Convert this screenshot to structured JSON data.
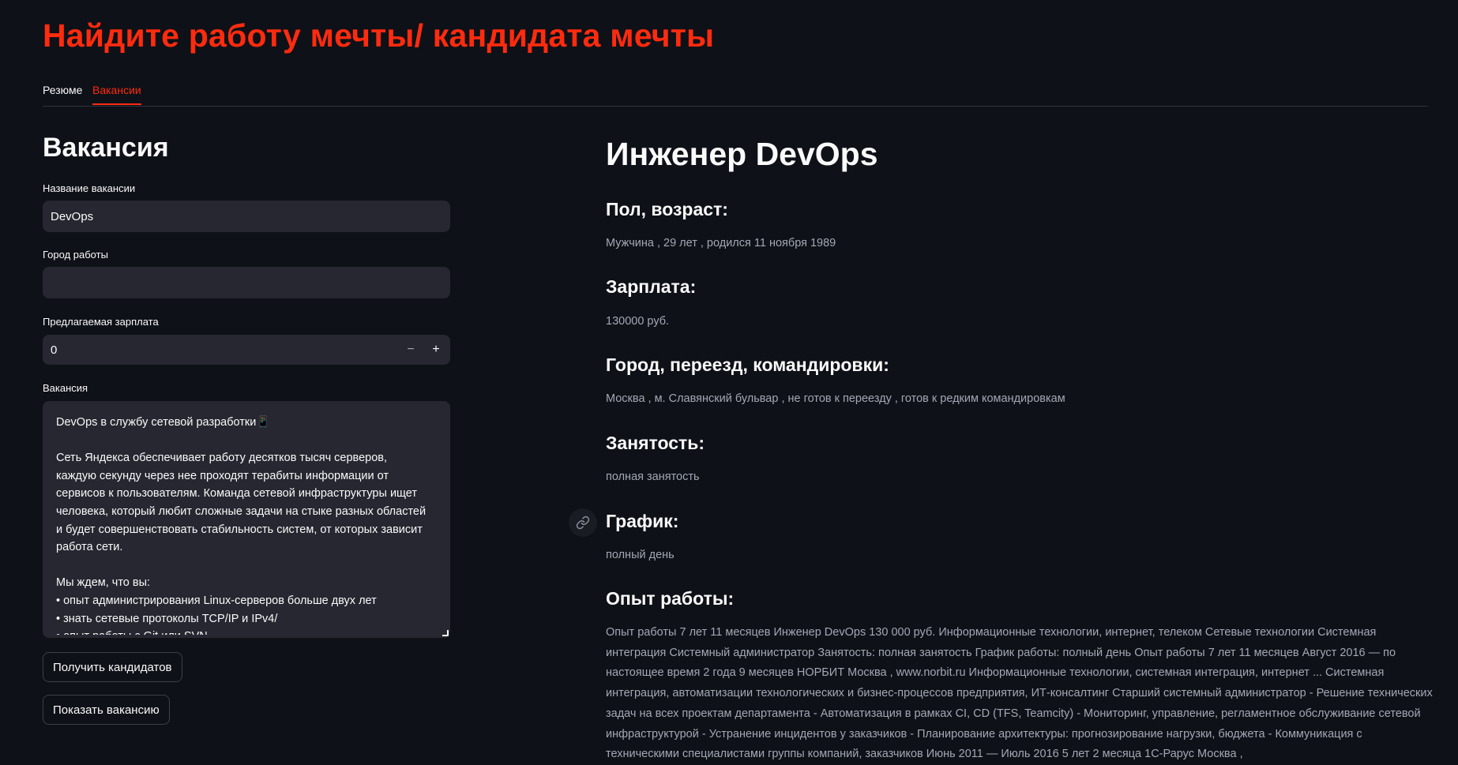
{
  "app": {
    "title": "Найдите работу мечты/ кандидата мечты"
  },
  "tabs": [
    {
      "label": "Резюме",
      "active": false
    },
    {
      "label": "Вакансии",
      "active": true
    }
  ],
  "form": {
    "section_title": "Вакансия",
    "title_label": "Название вакансии",
    "title_value": "DevOps",
    "city_label": "Город работы",
    "city_value": "",
    "salary_label": "Предлагаемая зарплата",
    "salary_value": "0",
    "minus_label": "−",
    "plus_label": "+",
    "description_label": "Вакансия",
    "description_value": "DevOps в службу сетевой разработки📱\n\nСеть Яндекса обеспечивает работу десятков тысяч серверов, каждую секунду через нее проходят терабиты информации от сервисов к пользователям. Команда сетевой инфраструктуры ищет человека, который любит сложные задачи на стыке разных областей и будет совершенствовать стабильность систем, от которых зависит работа сети.\n\nМы ждем, что вы:\n• опыт администрирования Linux-серверов больше двух лет\n• знать сетевые протоколы TCP/IP и IPv4/\n• опыт работы с Git или SVN",
    "get_candidates_button": "Получить кандидатов",
    "show_vacancy_button": "Показать вакансию"
  },
  "result": {
    "title": "Инженер DevOps",
    "gender_age_heading": "Пол, возраст:",
    "gender_age_value": "Мужчина , 29 лет , родился 11 ноября 1989",
    "salary_heading": "Зарплата:",
    "salary_value": "130000 руб.",
    "city_heading": "Город, переезд, командировки:",
    "city_value": "Москва , м. Славянский бульвар , не готов к переезду , готов к редким командировкам",
    "employment_heading": "Занятость:",
    "employment_value": "полная занятость",
    "schedule_heading": "График:",
    "schedule_value": "полный день",
    "experience_heading": "Опыт работы:",
    "experience_value": "Опыт работы 7 лет 11 месяцев Инженер DevOps 130 000 руб. Информационные технологии, интернет, телеком Сетевые технологии Системная интеграция Системный администратор Занятость: полная занятость График работы: полный день Опыт работы 7 лет 11 месяцев Август 2016 — по настоящее время 2 года 9 месяцев НОРБИТ Москва , www.norbit.ru Информационные технологии, системная интеграция, интернет ... Системная интеграция, автоматизации технологических и бизнес-процессов предприятия, ИТ-консалтинг Старший системный администратор - Решение технических задач на всех проектам департамента - Автоматизация в рамках CI, CD (TFS, Teamcity) - Мониторинг, управление, регламентное обслуживание сетевой инфраструктурой - Устранение инцидентов у заказчиков - Планирование архитектуры: прогнозирование нагрузки, бюджета - Коммуникация с техническими специалистами группы компаний, заказчиков Июнь 2011 — Июль 2016 5 лет 2 месяца 1С-Рарус Москва ,"
  },
  "colors": {
    "background": "#0e1117",
    "accent": "#ff2b0f",
    "input_bg": "#262730",
    "text": "#fafafa",
    "muted_text": "#a3a8b4"
  },
  "icons": {
    "anchor": "link-icon"
  }
}
